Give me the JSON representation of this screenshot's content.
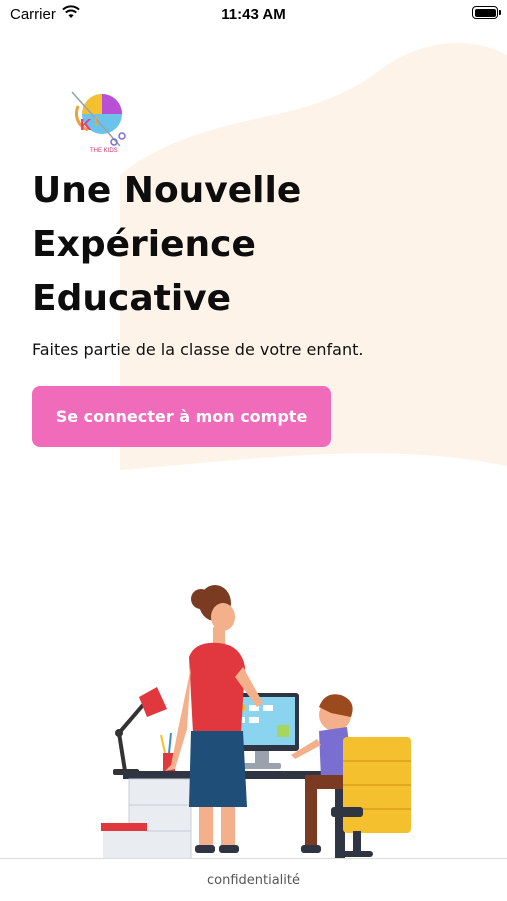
{
  "status_bar": {
    "carrier": "Carrier",
    "time": "11:43 AM",
    "icons": [
      "wifi-icon",
      "battery-icon"
    ]
  },
  "logo": {
    "text": "THE KIDS",
    "icon": "app-logo-icon"
  },
  "headline": {
    "line1": "Une Nouvelle",
    "line2": "Expérience",
    "line3": "Educative"
  },
  "subtitle": "Faites partie de la classe de votre enfant.",
  "login_button": {
    "label": "Se connecter à mon compte",
    "color": "#f06cba"
  },
  "illustration": {
    "icon": "teacher-student-computer-illustration"
  },
  "footer": {
    "link_label": "confidentialité"
  },
  "colors": {
    "background": "#ffffff",
    "blob": "#fdf3e8",
    "accent": "#f06cba",
    "text": "#0d0d0d"
  }
}
